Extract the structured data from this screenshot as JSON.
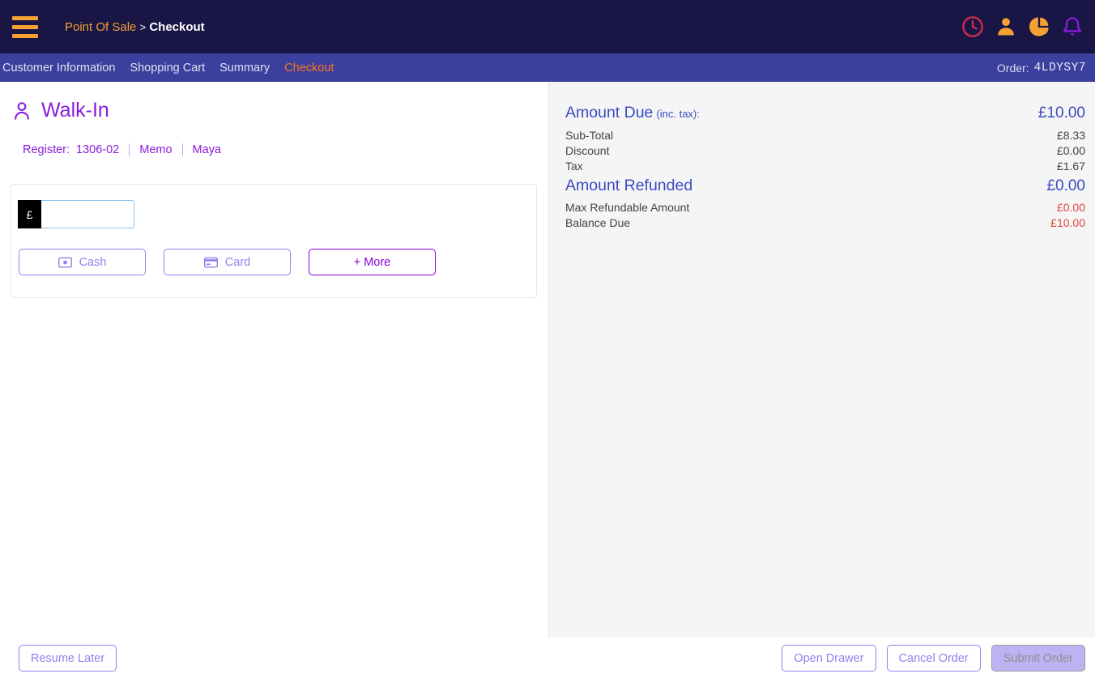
{
  "topbar": {
    "menu_icon": "hamburger-icon",
    "breadcrumb_root": "Point Of Sale",
    "breadcrumb_sep": ">",
    "breadcrumb_current": "Checkout",
    "icons": [
      "clock-icon",
      "user-icon",
      "pie-chart-icon",
      "bell-icon"
    ],
    "colors": {
      "background": "#191544",
      "accent_orange": "#f5a033",
      "clock": "#d42a4f",
      "user": "#f5a033",
      "pie": "#f5a033",
      "bell": "#8a1bdd"
    }
  },
  "nav": {
    "items": [
      {
        "label": "Customer Information",
        "active": false
      },
      {
        "label": "Shopping Cart",
        "active": false
      },
      {
        "label": "Summary",
        "active": false
      },
      {
        "label": "Checkout",
        "active": true
      }
    ],
    "order_label": "Order:",
    "order_code": "4LDYSY7",
    "background": "#3b3f9e",
    "active_color": "#f5751f"
  },
  "customer": {
    "icon": "person-icon",
    "name": "Walk-In",
    "register_label": "Register:",
    "register_value": "1306-02",
    "memo_link": "Memo",
    "user_link": "Maya",
    "accent": "#8a1bdd"
  },
  "payment": {
    "currency_symbol": "£",
    "amount_value": "",
    "amount_placeholder": "",
    "buttons": [
      {
        "label": "Cash",
        "icon": "banknote-icon",
        "style": "default"
      },
      {
        "label": "Card",
        "icon": "credit-card-icon",
        "style": "default"
      },
      {
        "label": "+ More",
        "icon": "",
        "style": "emphasis"
      }
    ]
  },
  "summary": {
    "amount_due_title": "Amount Due",
    "amount_due_note": "(inc. tax):",
    "amount_due_value": "£10.00",
    "lines_top": [
      {
        "label": "Sub-Total",
        "value": "£8.33"
      },
      {
        "label": "Discount",
        "value": "£0.00"
      },
      {
        "label": "Tax",
        "value": "£1.67"
      }
    ],
    "amount_refunded_title": "Amount Refunded",
    "amount_refunded_value": "£0.00",
    "lines_bottom": [
      {
        "label": "Max Refundable Amount",
        "value": "£0.00"
      },
      {
        "label": "Balance Due",
        "value": "£10.00"
      }
    ],
    "heading_color": "#3b4cc0",
    "alert_color": "#e0473c"
  },
  "footer": {
    "resume_later": "Resume Later",
    "open_drawer": "Open Drawer",
    "cancel_order": "Cancel Order",
    "submit_order": "Submit Order",
    "submit_disabled": true
  }
}
